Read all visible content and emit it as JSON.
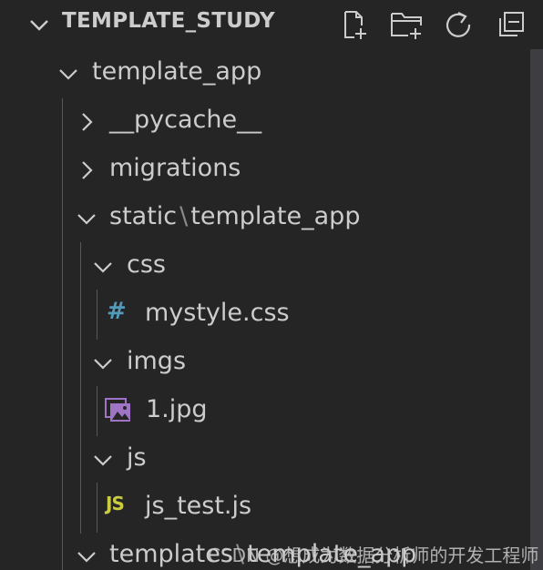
{
  "explorer": {
    "section_title": "TEMPLATE_STUDY",
    "actions": [
      {
        "name": "new-file",
        "icon": "new-file-icon"
      },
      {
        "name": "new-folder",
        "icon": "new-folder-icon"
      },
      {
        "name": "refresh",
        "icon": "refresh-icon"
      },
      {
        "name": "collapse-all",
        "icon": "collapse-all-icon"
      }
    ],
    "tree": {
      "template_app": "template_app",
      "pycache": "__pycache__",
      "migrations": "migrations",
      "static_part1": "static",
      "static_sep": "\\",
      "static_part2": "template_app",
      "css": "css",
      "mystyle": "mystyle.css",
      "imgs": "imgs",
      "jpg": "1.jpg",
      "js": "js",
      "js_test": "js_test.js",
      "templates_part1": "templates",
      "templates_sep": "\\",
      "templates_part2": "template_app"
    },
    "icons": {
      "css_glyph": "#",
      "js_glyph": "JS"
    }
  },
  "colors": {
    "background": "#252526",
    "text": "#cccccc",
    "css_icon": "#519aba",
    "js_icon": "#cbcb41",
    "image_icon": "#a074c4"
  },
  "watermark": "CSDN @想成为数据分析师的开发工程师"
}
